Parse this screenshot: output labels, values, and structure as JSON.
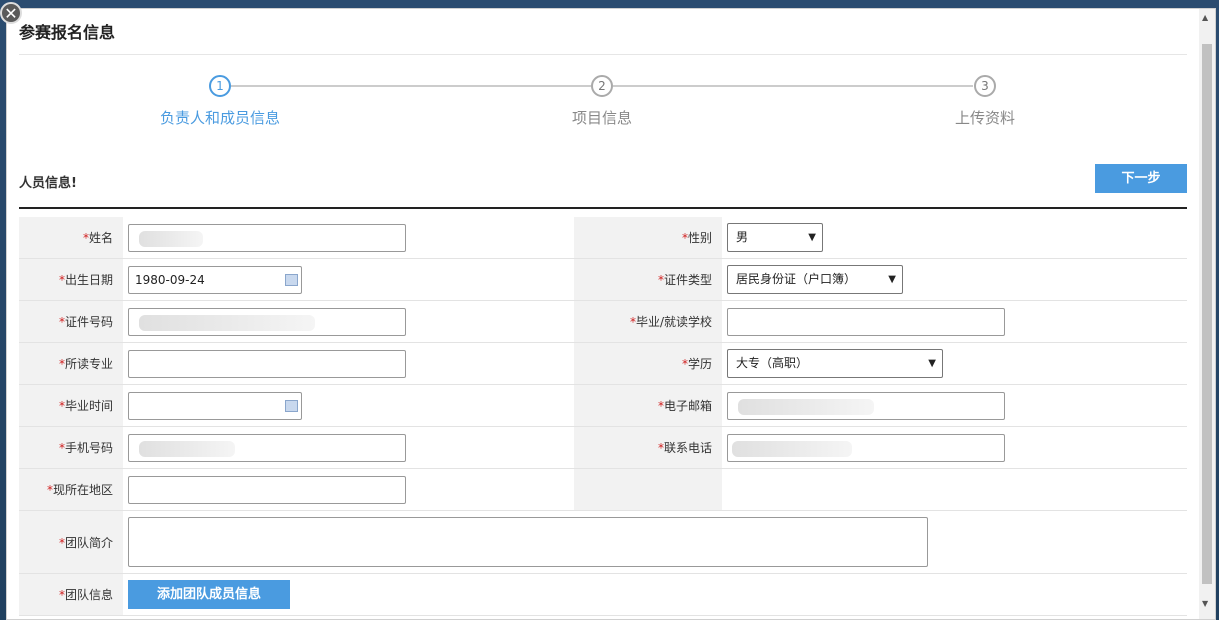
{
  "dialog": {
    "title": "参赛报名信息",
    "close_glyph": "✕"
  },
  "steps": [
    {
      "number": "1",
      "label": "负责人和成员信息",
      "active": true
    },
    {
      "number": "2",
      "label": "项目信息",
      "active": false
    },
    {
      "number": "3",
      "label": "上传资料",
      "active": false
    }
  ],
  "section": {
    "title": "人员信息!",
    "next_label": "下一步"
  },
  "form": {
    "required_mark": "*",
    "name_label": "姓名",
    "gender_label": "性别",
    "gender_value": "男",
    "birth_label": "出生日期",
    "birth_value": "1980-09-24",
    "id_type_label": "证件类型",
    "id_type_value": "居民身份证（户口簿）",
    "id_number_label": "证件号码",
    "school_label": "毕业/就读学校",
    "major_label": "所读专业",
    "education_label": "学历",
    "education_value": "大专（高职）",
    "grad_time_label": "毕业时间",
    "email_label": "电子邮箱",
    "mobile_label": "手机号码",
    "phone_label": "联系电话",
    "region_label": "现所在地区",
    "team_intro_label": "团队简介",
    "team_info_label": "团队信息",
    "add_member_label": "添加团队成员信息"
  },
  "icons": {
    "select_arrow": "▼",
    "scroll_up": "▲",
    "scroll_down": "▼"
  },
  "colors": {
    "accent": "#4a9be0",
    "required": "#d02020"
  }
}
